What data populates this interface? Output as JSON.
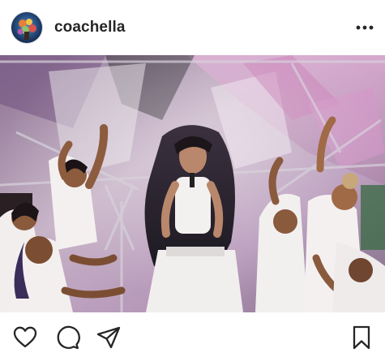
{
  "post": {
    "username": "coachella",
    "avatar_icon": "coachella-profile-avatar",
    "more_icon": "more-options-icon",
    "photo_description_icon": "concert-stage-performance-photo"
  },
  "actions": {
    "like_icon": "heart-icon",
    "comment_icon": "comment-bubble-icon",
    "share_icon": "paper-plane-share-icon",
    "save_icon": "bookmark-icon"
  },
  "colors": {
    "text": "#262626",
    "icon": "#262626",
    "background": "#ffffff"
  }
}
